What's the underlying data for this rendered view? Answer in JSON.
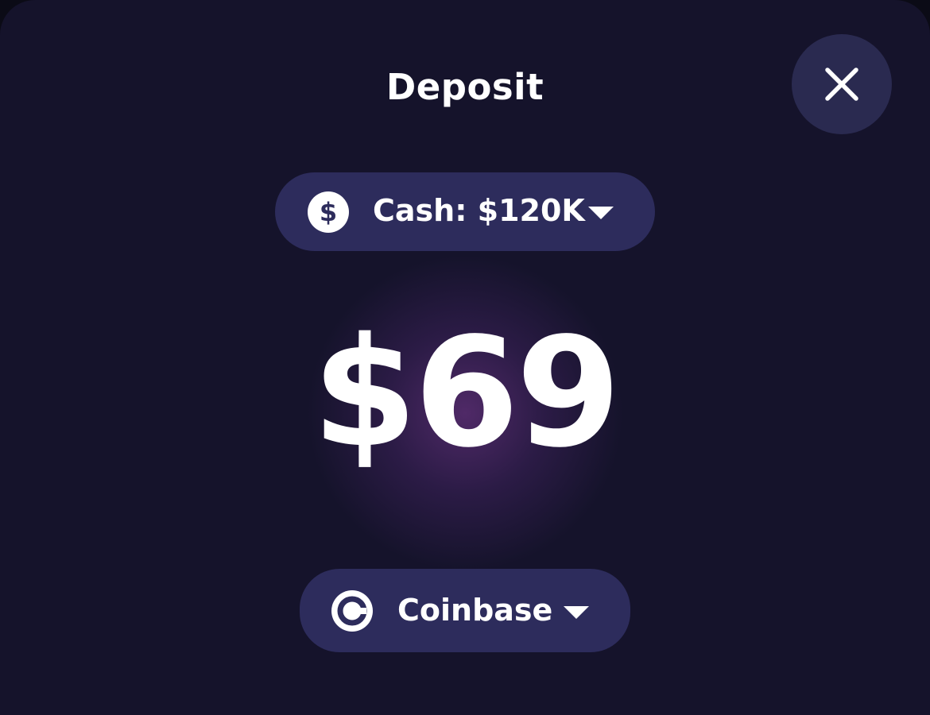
{
  "modal": {
    "title": "Deposit",
    "close_icon": "close-icon"
  },
  "balance_selector": {
    "icon": "dollar-coin-icon",
    "label": "Cash: $120K",
    "caret_icon": "caret-down-icon"
  },
  "amount": {
    "value": "$69"
  },
  "payment_method": {
    "icon": "coinbase-logo-icon",
    "label": "Coinbase",
    "caret_icon": "caret-down-icon"
  },
  "colors": {
    "background": "#15132b",
    "pill": "#2d2c5c",
    "close_button": "#2a2a50",
    "glow": "#562c6e",
    "text": "#ffffff"
  }
}
